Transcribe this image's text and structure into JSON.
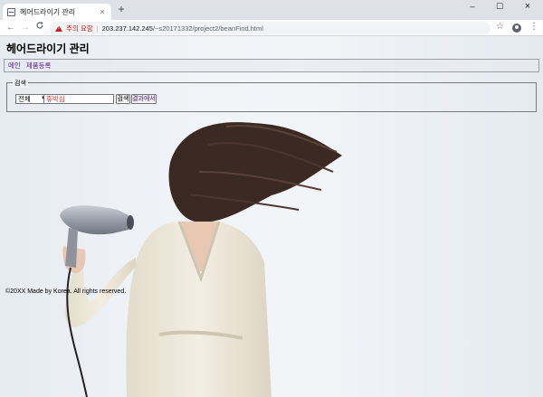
{
  "browser": {
    "tab_title": "헤어드라이기 관리",
    "tab_close": "×",
    "new_tab": "+",
    "window_controls": {
      "minimize": "–",
      "maximize": "☐",
      "close": "×"
    },
    "nav": {
      "back": "←",
      "forward": "→",
      "reload": "C"
    },
    "omnibox": {
      "security_label": "주의 요함",
      "separator": "|",
      "url_host": "203.237.142.245",
      "url_path": "/~s20171332/project2/beanFind.html"
    },
    "bookmark_icon": "☆",
    "menu_icon": "⋮"
  },
  "page": {
    "title": "헤어드라이기 관리",
    "nav_links": [
      "메인",
      "제품등록"
    ],
    "search": {
      "legend": "검색",
      "select_value": "전체",
      "input_value": "휴박심",
      "search_button": "검색",
      "result_button": "결과에서"
    },
    "footer": "©20XX Made by Korea. All rights reserved."
  }
}
